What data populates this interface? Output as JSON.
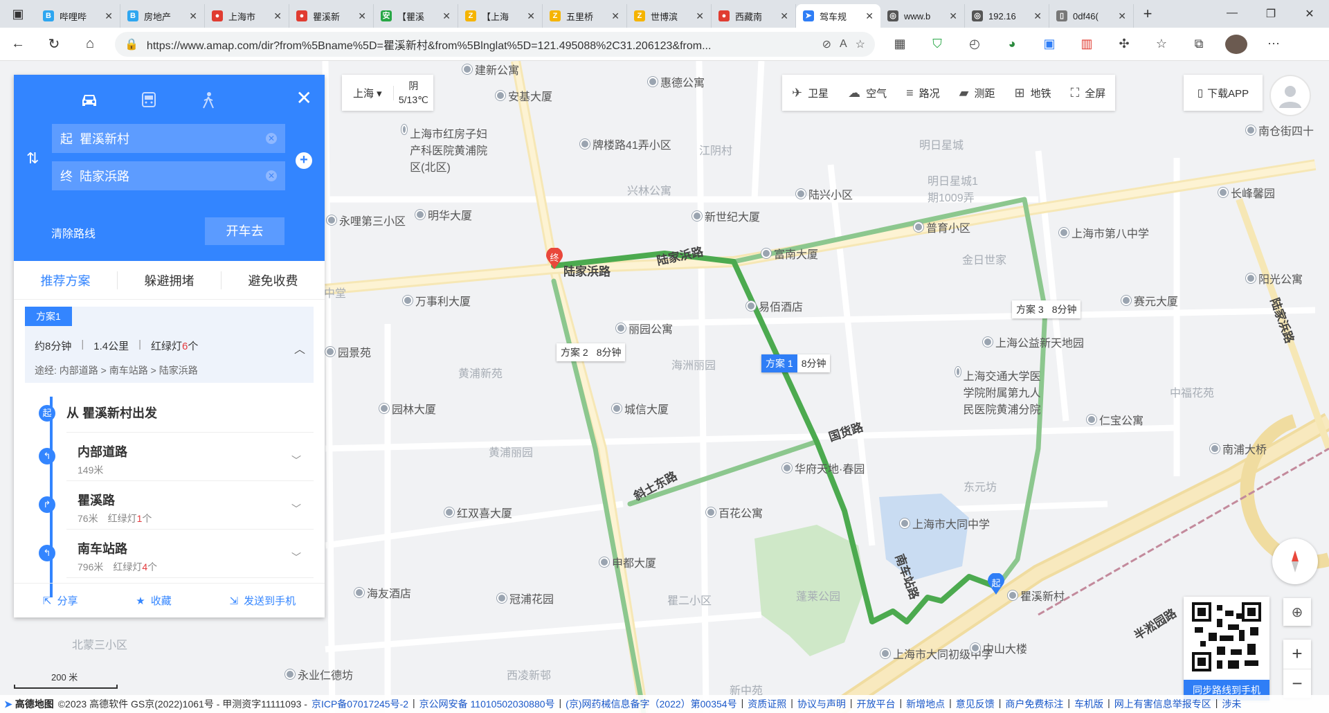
{
  "browser": {
    "tabs": [
      {
        "label": "哔哩哔",
        "color": "#2ea6f0",
        "glyph": "B"
      },
      {
        "label": "房地产",
        "color": "#2ea6f0",
        "glyph": "B"
      },
      {
        "label": "上海市",
        "color": "#e03c31",
        "glyph": "●"
      },
      {
        "label": "瞿溪新",
        "color": "#e03c31",
        "glyph": "●"
      },
      {
        "label": "【瞿溪",
        "color": "#27a745",
        "glyph": "安"
      },
      {
        "label": "【上海",
        "color": "#f5b400",
        "glyph": "Z"
      },
      {
        "label": "五里桥",
        "color": "#f5b400",
        "glyph": "Z"
      },
      {
        "label": "世博滨",
        "color": "#f5b400",
        "glyph": "Z"
      },
      {
        "label": "西藏南",
        "color": "#e03c31",
        "glyph": "●"
      },
      {
        "label": "驾车规",
        "color": "#2f7ef6",
        "glyph": "➤",
        "active": true
      },
      {
        "label": "www.b",
        "color": "#555555",
        "glyph": "◎"
      },
      {
        "label": "192.16",
        "color": "#555555",
        "glyph": "◎"
      },
      {
        "label": "0df46(",
        "color": "#777777",
        "glyph": "▯"
      }
    ],
    "url": "https://www.amap.com/dir?from%5Bname%5D=瞿溪新村&from%5Blnglat%5D=121.495088%2C31.206123&from...",
    "ext_badge": "1"
  },
  "map_controls": {
    "city": "上海",
    "weather_cond": "阴",
    "weather_temp": "5/13℃",
    "tools": [
      {
        "label": "卫星",
        "icon": "satellite-icon",
        "glyph": "✈"
      },
      {
        "label": "空气",
        "icon": "air-icon",
        "glyph": "☁"
      },
      {
        "label": "路况",
        "icon": "traffic-icon",
        "glyph": "≡"
      },
      {
        "label": "测距",
        "icon": "ruler-icon",
        "glyph": "▰"
      },
      {
        "label": "地铁",
        "icon": "subway-icon",
        "glyph": "⊞"
      },
      {
        "label": "全屏",
        "icon": "fullscreen-icon",
        "glyph": "⛶"
      }
    ],
    "download": "下载APP",
    "qr_label": "同步路线到手机",
    "scale": "200 米"
  },
  "panel": {
    "from": "瞿溪新村",
    "to": "陆家浜路",
    "from_prefix": "起",
    "to_prefix": "终",
    "clear": "清除路线",
    "go": "开车去",
    "tabs": [
      "推荐方案",
      "躲避拥堵",
      "避免收费"
    ],
    "plan": {
      "badge": "方案1",
      "time": "约8分钟",
      "distance": "1.4公里",
      "lights_prefix": "红绿灯",
      "lights_count": "6",
      "lights_suffix": "个",
      "via": "途经:  内部道路 > 南车站路 > 陆家浜路"
    },
    "start_step": "从 瞿溪新村出发",
    "start_icon": "起",
    "steps": [
      {
        "title": "内部道路",
        "dist": "149米",
        "lights": "",
        "lights_count": "",
        "icon": "↰"
      },
      {
        "title": "瞿溪路",
        "dist": "76米",
        "lights": "红绿灯",
        "lights_count": "1",
        "lights_suffix": "个",
        "icon": "↱"
      },
      {
        "title": "南车站路",
        "dist": "796米",
        "lights": "红绿灯",
        "lights_count": "4",
        "lights_suffix": "个",
        "icon": "↰"
      }
    ],
    "actions": [
      "分享",
      "收藏",
      "发送到手机"
    ]
  },
  "map_labels": {
    "pois": [
      {
        "t": "建新公寓"
      },
      {
        "t": "惠德公寓"
      },
      {
        "t": "安基大厦"
      },
      {
        "t": "上海市红房子妇产科医院黄浦院区(北区)"
      },
      {
        "t": "牌楼路41弄小区"
      },
      {
        "t": "陆兴小区"
      },
      {
        "t": "明华大厦"
      },
      {
        "t": "新世纪大厦"
      },
      {
        "t": "普育小区"
      },
      {
        "t": "上海市第八中学"
      },
      {
        "t": "富南大厦"
      },
      {
        "t": "长峰馨园"
      },
      {
        "t": "南仓街四十"
      },
      {
        "t": "永哩第三小区"
      },
      {
        "t": "万事利大厦"
      },
      {
        "t": "易佰酒店"
      },
      {
        "t": "丽园公寓"
      },
      {
        "t": "阳光公寓"
      },
      {
        "t": "赛元大厦"
      },
      {
        "t": "园景苑"
      },
      {
        "t": "上海公益新天地园"
      },
      {
        "t": "上海交通大学医学院附属第九人民医院黄浦分院"
      },
      {
        "t": "园林大厦"
      },
      {
        "t": "城信大厦"
      },
      {
        "t": "仁宝公寓"
      },
      {
        "t": "华府天地·春园"
      },
      {
        "t": "南浦大桥"
      },
      {
        "t": "红双喜大厦"
      },
      {
        "t": "百花公寓"
      },
      {
        "t": "上海市大同中学"
      },
      {
        "t": "申都大厦"
      },
      {
        "t": "海友酒店"
      },
      {
        "t": "冠浦花园"
      },
      {
        "t": "瞿溪新村"
      },
      {
        "t": "上海市大同初级中学"
      },
      {
        "t": "中山大楼"
      },
      {
        "t": "永业仁德坊"
      }
    ],
    "areas": [
      {
        "t": "江阴村"
      },
      {
        "t": "明日星城"
      },
      {
        "t": "兴林公寓"
      },
      {
        "t": "明日星城1期1009弄"
      },
      {
        "t": "金日世家"
      },
      {
        "t": "海洲丽园"
      },
      {
        "t": "黄浦新苑"
      },
      {
        "t": "中福花苑"
      },
      {
        "t": "黄浦丽园"
      },
      {
        "t": "东元坊"
      },
      {
        "t": "蓬莱公园"
      },
      {
        "t": "瞿二小区"
      },
      {
        "t": "北蒙三小区"
      },
      {
        "t": "西凌新邨"
      },
      {
        "t": "新中苑"
      },
      {
        "t": "中堂"
      }
    ],
    "roads": [
      {
        "t": "陆家浜路"
      },
      {
        "t": "陆家浜路"
      },
      {
        "t": "国货路"
      },
      {
        "t": "斜土东路"
      },
      {
        "t": "南车站路"
      },
      {
        "t": "陆家浜路"
      },
      {
        "t": "半淞园路"
      }
    ],
    "plans": [
      {
        "name": "方案 1",
        "time": "8分钟",
        "selected": true
      },
      {
        "name": "方案 2",
        "time": "8分钟",
        "selected": false
      },
      {
        "name": "方案 3",
        "time": "8分钟",
        "selected": false
      }
    ],
    "end_marker": "终",
    "start_marker": "起"
  },
  "footer": {
    "brand": "高德地图",
    "copyright": "©2023 高德软件 GS京(2022)1061号 - 甲测资字11111093 -",
    "links": [
      "京ICP备07017245号-2",
      "京公网安备 11010502030880号",
      "(京)网药械信息备字（2022）第00354号",
      "资质证照",
      "协议与声明",
      "开放平台",
      "新增地点",
      "意见反馈",
      "商户免费标注",
      "车机版",
      "网上有害信息举报专区",
      "涉未"
    ]
  }
}
